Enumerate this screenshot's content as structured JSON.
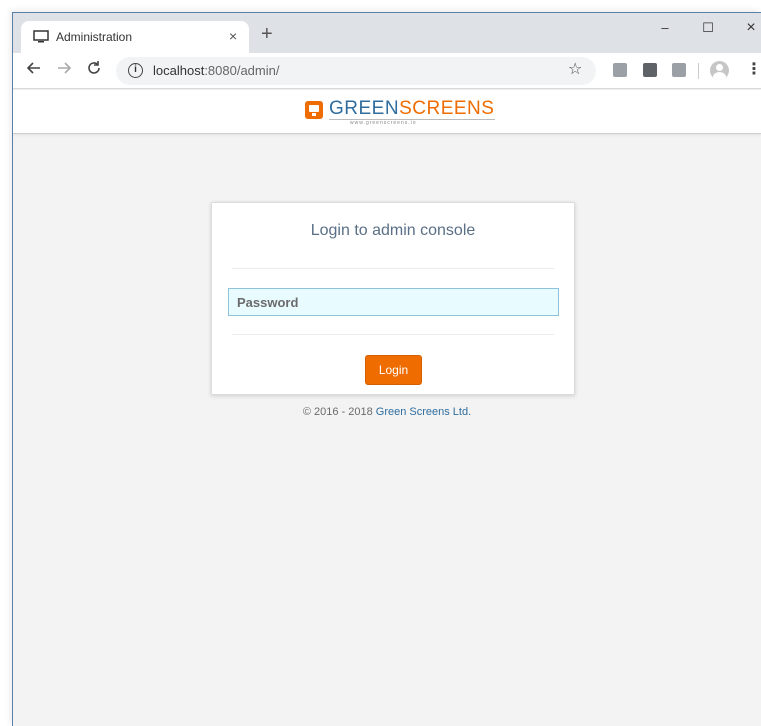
{
  "browser": {
    "tab_title": "Administration",
    "tab_close": "×",
    "new_tab": "+",
    "url_host": "localhost",
    "url_rest": ":8080/admin/",
    "window_controls": {
      "minimize": "–",
      "maximize": "☐",
      "close": "×"
    },
    "icons": {
      "favicon": "monitor-icon",
      "back": "arrow-left-icon",
      "forward": "arrow-right-icon",
      "reload": "reload-icon",
      "info": "info-icon",
      "bookmark": "star-icon",
      "menu": "kebab-menu-icon"
    }
  },
  "header": {
    "logo_green": "GREEN",
    "logo_screens": "SCREENS",
    "logo_tagline": "www.greenscreens.io"
  },
  "login": {
    "title": "Login to admin console",
    "password_placeholder": "Password",
    "button_label": "Login"
  },
  "footer": {
    "copyright": "© 2016 - 2018 ",
    "company": "Green Screens Ltd."
  },
  "colors": {
    "accent": "#ef6c00",
    "brand_blue": "#2f6d9e",
    "input_bg": "#e8fbff",
    "page_bg": "#f3f3f3"
  }
}
